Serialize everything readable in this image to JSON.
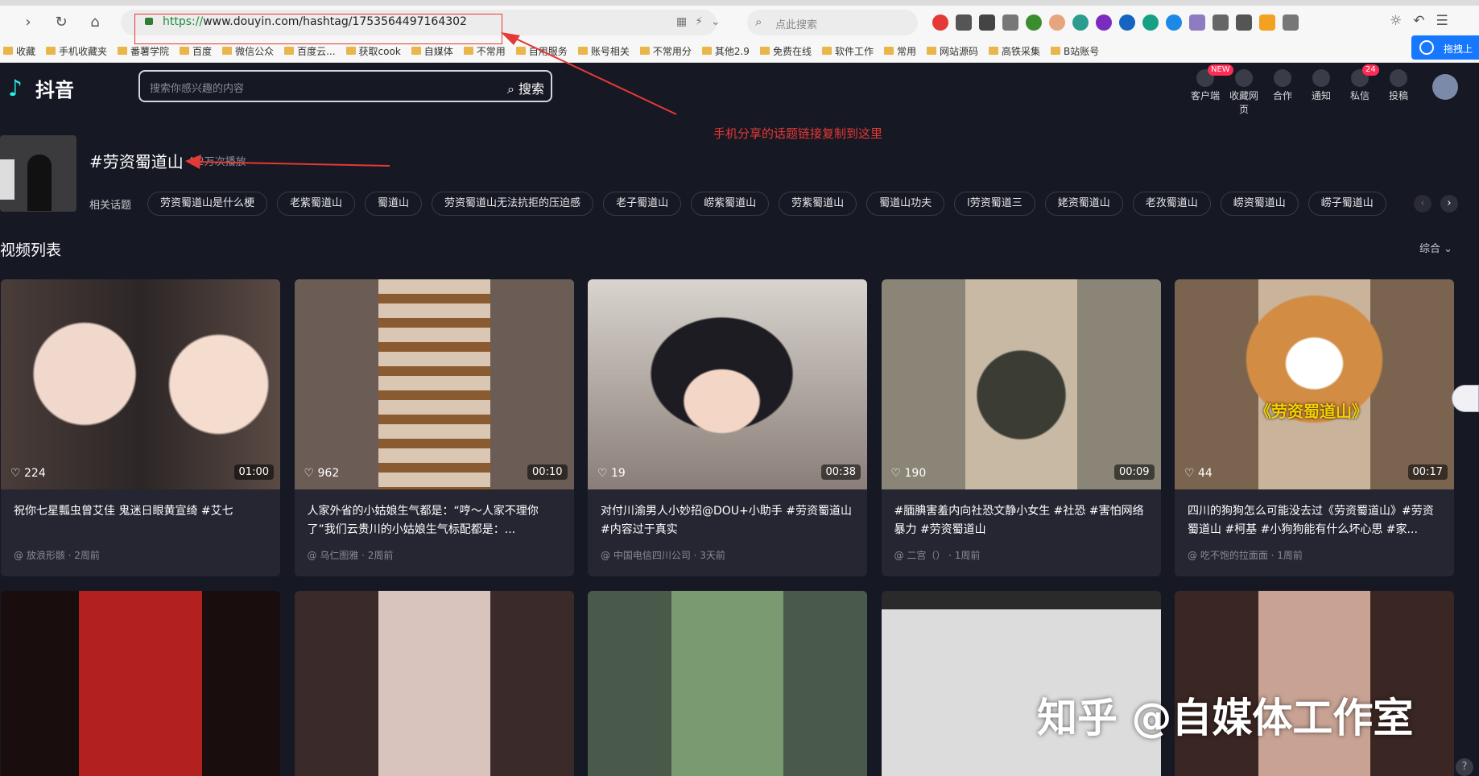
{
  "browser": {
    "url_scheme": "https://",
    "url_rest": "www.douyin.com/hashtag/1753564497164302",
    "search_placeholder": "点此搜索",
    "bookmarks": [
      "收藏",
      "手机收藏夹",
      "番薯学院",
      "百度",
      "微信公众",
      "百度云...",
      "获取cook",
      "自媒体",
      "不常用",
      "自用服务",
      "账号相关",
      "不常用分",
      "其他2.9",
      "免费在线",
      "软件工作",
      "常用",
      "网站源码",
      "高铁采集",
      "B站账号"
    ],
    "tuo_label": "拖拽上"
  },
  "douyin": {
    "logo_text": "抖音",
    "search_placeholder": "搜索你感兴趣的内容",
    "search_button": "搜索",
    "top_icons": [
      {
        "label": "客户端",
        "badge": "NEW",
        "icon": "client-icon"
      },
      {
        "label": "收藏网页",
        "badge": "",
        "icon": "star-icon"
      },
      {
        "label": "合作",
        "badge": "",
        "icon": "cooperation-icon"
      },
      {
        "label": "通知",
        "badge": "",
        "icon": "bell-icon"
      },
      {
        "label": "私信",
        "badge": "24",
        "icon": "message-icon"
      },
      {
        "label": "投稿",
        "badge": "",
        "icon": "upload-icon"
      }
    ]
  },
  "annotation": {
    "note": "手机分享的话题链接复制到这里",
    "color": "#e53935"
  },
  "hashtag": {
    "title": "#劳资蜀道山",
    "views": "4.2万次播放"
  },
  "related": {
    "label": "相关话题",
    "chips": [
      "劳资蜀道山是什么梗",
      "老紫蜀道山",
      "蜀道山",
      "劳资蜀道山无法抗拒的压迫感",
      "老子蜀道山",
      "崂紫蜀道山",
      "劳紫蜀道山",
      "蜀道山功夫",
      "l劳资蜀道三",
      "姥资蜀道山",
      "老孜蜀道山",
      "崂资蜀道山",
      "崂子蜀道山"
    ]
  },
  "list": {
    "title": "视频列表",
    "sort": "综合",
    "cards": [
      {
        "likes": "224",
        "duration": "01:00",
        "desc": "祝你七星瓢虫曾艾佳 鬼迷日眼黄宣绮 #艾七",
        "author": "放浪形骸",
        "time": "2周前"
      },
      {
        "likes": "962",
        "duration": "00:10",
        "desc": "人家外省的小姑娘生气都是：“哼～人家不理你了”我们云贵川的小姑娘生气标配都是：...",
        "author": "乌仁图雅",
        "time": "2周前"
      },
      {
        "likes": "19",
        "duration": "00:38",
        "desc": "对付川渝男人小妙招@DOU+小助手 #劳资蜀道山 #内容过于真实",
        "author": "中国电信四川公司",
        "time": "3天前"
      },
      {
        "likes": "190",
        "duration": "00:09",
        "desc": "#腼腆害羞内向社恐文静小女生 #社恐 #害怕网络暴力 #劳资蜀道山",
        "author": "二宫（）",
        "time": "1周前"
      },
      {
        "likes": "44",
        "duration": "00:17",
        "desc": "四川的狗狗怎么可能没去过《劳资蜀道山》#劳资蜀道山 #柯基 #小狗狗能有什么坏心思 #家...",
        "author": "吃不饱的拉面面",
        "time": "1周前"
      }
    ],
    "dog_caption": "《劳资蜀道山》"
  },
  "watermark": "知乎 @自媒体工作室"
}
